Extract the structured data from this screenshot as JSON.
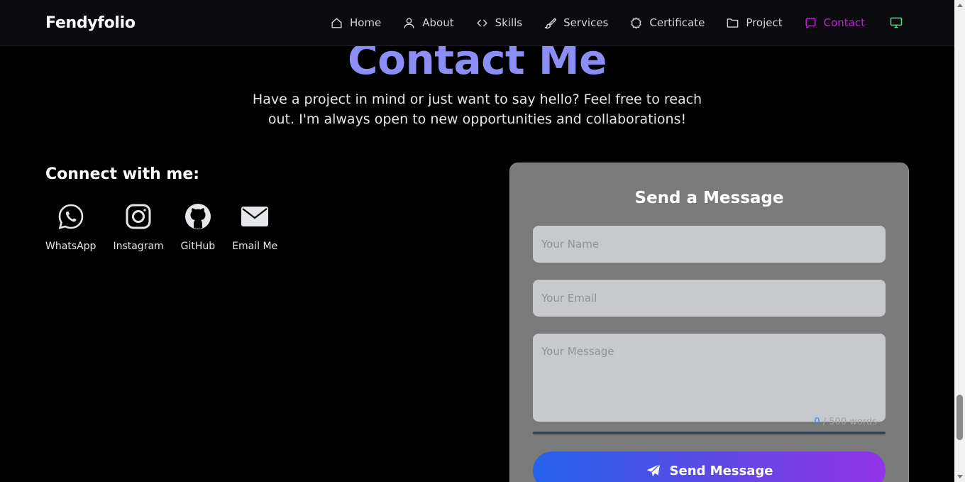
{
  "navbar": {
    "brand": "Fendyfolio",
    "items": [
      {
        "label": "Home",
        "icon": "home-icon"
      },
      {
        "label": "About",
        "icon": "user-icon"
      },
      {
        "label": "Skills",
        "icon": "code-icon"
      },
      {
        "label": "Services",
        "icon": "brush-icon"
      },
      {
        "label": "Certificate",
        "icon": "badge-icon"
      },
      {
        "label": "Project",
        "icon": "folder-icon"
      },
      {
        "label": "Contact",
        "icon": "chat-icon",
        "active": true
      }
    ],
    "theme_toggle_icon": "monitor-icon"
  },
  "hero": {
    "title": "Contact Me",
    "subtitle": "Have a project in mind or just want to say hello? Feel free to reach out. I'm always open to new opportunities and collaborations!"
  },
  "connect": {
    "title": "Connect with me:",
    "links": [
      {
        "label": "WhatsApp",
        "icon": "whatsapp-icon"
      },
      {
        "label": "Instagram",
        "icon": "instagram-icon"
      },
      {
        "label": "GitHub",
        "icon": "github-icon"
      },
      {
        "label": "Email Me",
        "icon": "mail-icon"
      }
    ]
  },
  "form": {
    "title": "Send a Message",
    "name_placeholder": "Your Name",
    "email_placeholder": "Your Email",
    "message_placeholder": "Your Message",
    "name_value": "",
    "email_value": "",
    "message_value": "",
    "word_count": "0",
    "word_limit_text": " / 500 words",
    "progress_fraction": 0,
    "submit_label": "Send Message",
    "submit_icon": "paper-plane-icon"
  },
  "colors": {
    "title_accent": "#8b8ff5",
    "active_nav": "#c026d3",
    "theme_icon": "#4ade80",
    "button_gradient_start": "#2563eb",
    "button_gradient_end": "#9333ea"
  }
}
